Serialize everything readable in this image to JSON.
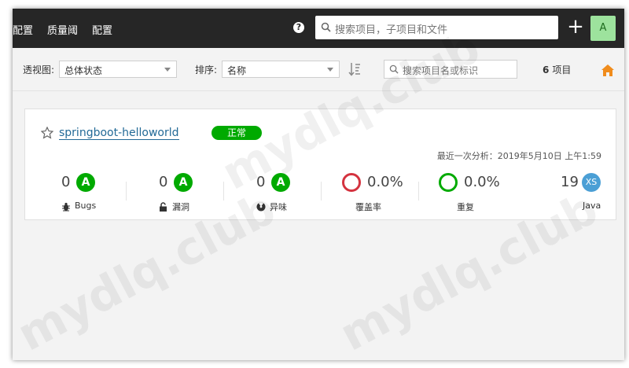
{
  "nav": {
    "items": [
      "配置",
      "质量阈",
      "配置"
    ],
    "search_placeholder": "搜索项目，子项目和文件",
    "plus_label": "+",
    "avatar_letter": "A"
  },
  "filters": {
    "view_label": "透视图:",
    "view_value": "总体状态",
    "sort_label": "排序:",
    "sort_value": "名称",
    "search_placeholder": "搜索项目名或标识",
    "count_number": "6",
    "count_unit": "项目"
  },
  "project": {
    "name": "springboot-helloworld",
    "status": "正常",
    "last_analysis": "最近一次分析：2019年5月10日 上午1:59",
    "metrics": {
      "bugs": {
        "value": "0",
        "grade": "A",
        "label": "Bugs"
      },
      "vulnerabilities": {
        "value": "0",
        "grade": "A",
        "label": "漏洞"
      },
      "code_smells": {
        "value": "0",
        "grade": "A",
        "label": "异味"
      },
      "coverage": {
        "value": "0.0%",
        "label": "覆盖率"
      },
      "duplications": {
        "value": "0.0%",
        "label": "重复"
      },
      "size": {
        "value": "19",
        "badge": "XS",
        "label": "Java"
      }
    }
  },
  "colors": {
    "topbar": "#262626",
    "grade_a": "#00aa00",
    "coverage_ring": "#d4333f",
    "dup_ring": "#00aa00",
    "size_badge": "#4b9fd5",
    "link": "#236a97"
  },
  "watermark": "mydlq.club"
}
